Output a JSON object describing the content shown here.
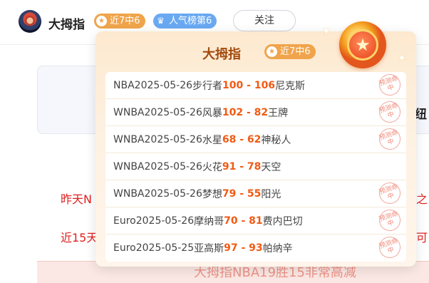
{
  "header": {
    "name": "大拇指",
    "badge_streak": "近7中6",
    "badge_rank": "人气榜第6",
    "follow_label": "关注"
  },
  "background": {
    "right_fragment": "纽",
    "red_line_1_left": "昨天N",
    "red_line_1_right": "之",
    "red_line_2_left": "近15天",
    "red_line_2_right": "可",
    "bottom_text": "大拇指NBA19胜15非常高减"
  },
  "popup": {
    "title": "大拇指",
    "badge": "近7中6",
    "stamp_text": "预测命中",
    "results": [
      {
        "league": "NBA",
        "date": "2025-05-26",
        "home": "步行者",
        "home_score": "100",
        "sep": " - ",
        "away_score": "106",
        "away": "尼克斯",
        "hit": true
      },
      {
        "league": "WNBA",
        "date": "2025-05-26",
        "home": "风暴",
        "home_score": "102",
        "sep": " - ",
        "away_score": "82",
        "away": "王牌",
        "hit": true
      },
      {
        "league": "WNBA",
        "date": "2025-05-26",
        "home": "水星",
        "home_score": "68",
        "sep": " - ",
        "away_score": "62",
        "away": "神秘人",
        "hit": true
      },
      {
        "league": "WNBA",
        "date": "2025-05-26",
        "home": "火花",
        "home_score": "91",
        "sep": " - ",
        "away_score": "78",
        "away": "天空",
        "hit": false
      },
      {
        "league": "WNBA",
        "date": "2025-05-26",
        "home": "梦想",
        "home_score": "79",
        "sep": " - ",
        "away_score": "55",
        "away": "阳光",
        "hit": true
      },
      {
        "league": "Euro",
        "date": "2025-05-26",
        "home": "摩纳哥",
        "home_score": "70",
        "sep": " - ",
        "away_score": "81",
        "away": "费内巴切",
        "hit": true
      },
      {
        "league": "Euro",
        "date": "2025-05-25",
        "home": "亚高斯",
        "home_score": "97",
        "sep": " - ",
        "away_score": "93",
        "away": "帕纳辛",
        "hit": true
      }
    ]
  },
  "colors": {
    "score": "#f05a14",
    "badge_streak": "#f0a44b",
    "badge_rank": "#6aa9f2",
    "title": "#a24a0c"
  },
  "icons": {
    "streak": "medal-icon",
    "rank": "crown-icon",
    "popup_medal": "star-medal-icon"
  }
}
